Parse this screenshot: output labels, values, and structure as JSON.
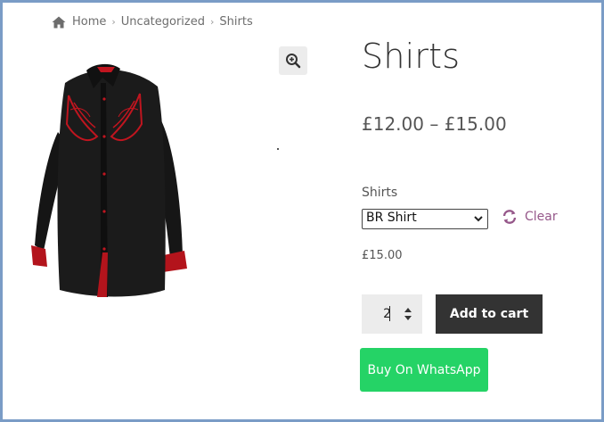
{
  "breadcrumb": {
    "icon": "home-icon",
    "items": [
      "Home",
      "Uncategorized",
      "Shirts"
    ]
  },
  "product": {
    "image_icon": "shirt-image",
    "zoom_icon": "magnify-plus-icon",
    "title": "Shirts",
    "price_range": "£12.00 – £15.00",
    "variation_label": "Shirts",
    "variation_selected": "BR Shirt",
    "clear_label": "Clear",
    "clear_icon": "refresh-icon",
    "variation_price": "£15.00",
    "quantity": "2",
    "add_to_cart_label": "Add to cart",
    "whatsapp_label": "Buy On WhatsApp"
  },
  "colors": {
    "accent": "#96588a",
    "whatsapp": "#25d366",
    "dark_button": "#333333",
    "frame_border": "#7a9cc6"
  }
}
